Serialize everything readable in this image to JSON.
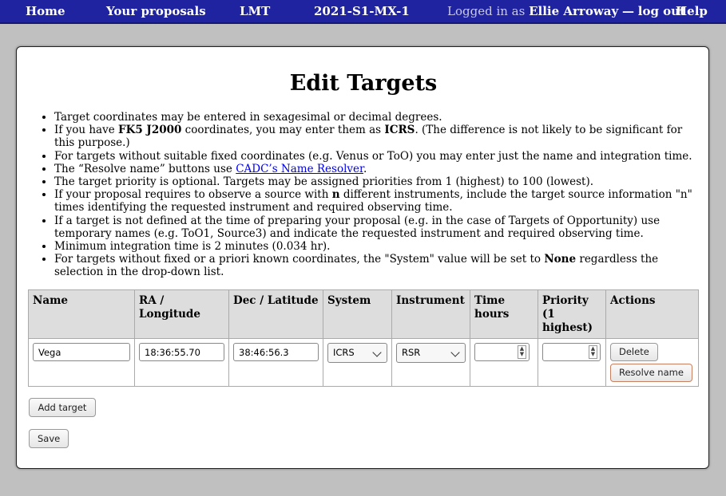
{
  "nav": {
    "home": "Home",
    "your_proposals": "Your proposals",
    "facility": "LMT",
    "semester": "2021-S1-MX-1",
    "logged_in_as": "Logged in as",
    "user": "Ellie Arroway",
    "separator": "—",
    "logout": "log out",
    "help": "Help"
  },
  "page": {
    "title": "Edit Targets"
  },
  "notes": {
    "n1": "Target coordinates may be entered in sexagesimal or decimal degrees.",
    "n2_a": "If you have ",
    "n2_b": "FK5 J2000",
    "n2_c": " coordinates, you may enter them as ",
    "n2_d": "ICRS",
    "n2_e": ". (The difference is not likely to be significant for this purpose.)",
    "n3": "For targets without suitable fixed coordinates (e.g. Venus or ToO) you may enter just the name and integration time.",
    "n4_a": "The “Resolve name” buttons use ",
    "n4_link": "CADC’s Name Resolver",
    "n4_b": ".",
    "n5": "The target priority is optional. Targets may be assigned priorities from 1 (highest) to 100 (lowest).",
    "n6_a": "If your proposal requires to observe a source with ",
    "n6_b": "n",
    "n6_c": " different instruments, include the target source information \"n\" times identifying the requested instrument and required observing time.",
    "n7": "If a target is not defined at the time of preparing your proposal (e.g. in the case of Targets of Opportunity) use temporary names (e.g. ToO1, Source3) and indicate the requested instrument and required observing time.",
    "n8": "Minimum integration time is 2 minutes (0.034 hr).",
    "n9_a": "For targets without fixed or a priori known coordinates, the \"System\" value will be set to ",
    "n9_b": "None",
    "n9_c": " regardless the selection in the drop-down list."
  },
  "table": {
    "headers": {
      "name": "Name",
      "ra": "RA / Longitude",
      "dec": "Dec / Latitude",
      "system": "System",
      "instrument": "Instrument",
      "time_1": "Time",
      "time_2": "hours",
      "priority_1": "Priority",
      "priority_2": "(1",
      "priority_3": "highest)",
      "actions": "Actions"
    },
    "rows": [
      {
        "name": "Vega",
        "ra": "18:36:55.70",
        "dec": "38:46:56.3",
        "system": "ICRS",
        "instrument": "RSR",
        "time": "",
        "priority": "",
        "delete_label": "Delete",
        "resolve_label": "Resolve name"
      }
    ]
  },
  "buttons": {
    "add_target": "Add target",
    "save": "Save"
  },
  "colors": {
    "nav_bg": "#1f23a0",
    "page_bg": "#c0c0c0",
    "header_cell_bg": "#dddddd",
    "link": "#0000ee"
  }
}
